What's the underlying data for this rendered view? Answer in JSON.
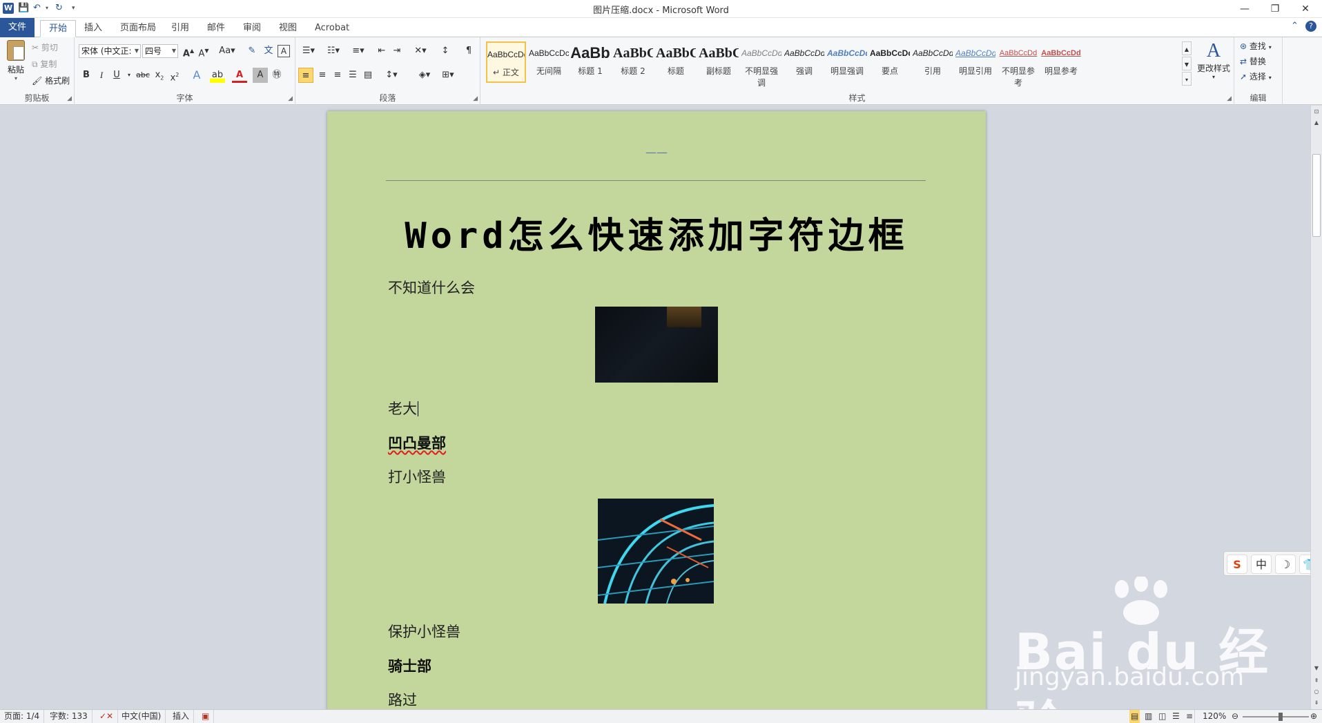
{
  "window": {
    "title": "图片压缩.docx - Microsoft Word",
    "app_icon": "W",
    "minimize": "—",
    "restore": "❐",
    "close": "✕"
  },
  "tabs": [
    {
      "label": "文件"
    },
    {
      "label": "开始"
    },
    {
      "label": "插入"
    },
    {
      "label": "页面布局"
    },
    {
      "label": "引用"
    },
    {
      "label": "邮件"
    },
    {
      "label": "审阅"
    },
    {
      "label": "视图"
    },
    {
      "label": "Acrobat"
    }
  ],
  "ribbon": {
    "clipboard": {
      "label": "剪贴板",
      "paste": "粘贴",
      "cut": "剪切",
      "copy": "复制",
      "format_painter": "格式刷"
    },
    "font": {
      "label": "字体",
      "font_name": "宋体 (中文正:",
      "font_size": "四号"
    },
    "paragraph": {
      "label": "段落"
    },
    "styles": {
      "label": "样式",
      "change_styles": "更改样式",
      "items": [
        {
          "preview": "AaBbCcDd",
          "name": "正文"
        },
        {
          "preview": "AaBbCcDc",
          "name": "无间隔"
        },
        {
          "preview": "AaBb",
          "name": "标题 1"
        },
        {
          "preview": "AaBbC",
          "name": "标题 2"
        },
        {
          "preview": "AaBbC",
          "name": "标题"
        },
        {
          "preview": "AaBbC",
          "name": "副标题"
        },
        {
          "preview": "AaBbCcDd",
          "name": "不明显强调"
        },
        {
          "preview": "AaBbCcDd",
          "name": "强调"
        },
        {
          "preview": "AaBbCcDd",
          "name": "明显强调"
        },
        {
          "preview": "AaBbCcDd",
          "name": "要点"
        },
        {
          "preview": "AaBbCcDd",
          "name": "引用"
        },
        {
          "preview": "AaBbCcDd",
          "name": "明显引用"
        },
        {
          "preview": "AaBbCcDd",
          "name": "不明显参考"
        },
        {
          "preview": "AaBbCcDd",
          "name": "明显参考"
        }
      ]
    },
    "editing": {
      "label": "编辑",
      "find": "查找",
      "replace": "替换",
      "select": "选择"
    }
  },
  "document": {
    "header_mark": "——",
    "title": "Word怎么快速添加字符边框",
    "paragraphs": [
      {
        "text": "不知道什么会"
      },
      {
        "text": "老大"
      },
      {
        "text": "凹凸曼部"
      },
      {
        "text": "打小怪兽"
      },
      {
        "text": "保护小怪兽"
      },
      {
        "text": "骑士部"
      },
      {
        "text": "路过"
      }
    ]
  },
  "ime": {
    "logo": "S",
    "lang": "中",
    "moon": "☽",
    "shirt": "👕"
  },
  "watermark": {
    "main": "Bai du 经验",
    "sub": "jingyan.baidu.com"
  },
  "status": {
    "page": "页面: 1/4",
    "words": "字数: 133",
    "language": "中文(中国)",
    "mode": "插入",
    "zoom": "120%"
  },
  "colors": {
    "page_bg": "#c3d69b",
    "accent": "#2b579a",
    "selected_style": "#f2c24a"
  }
}
